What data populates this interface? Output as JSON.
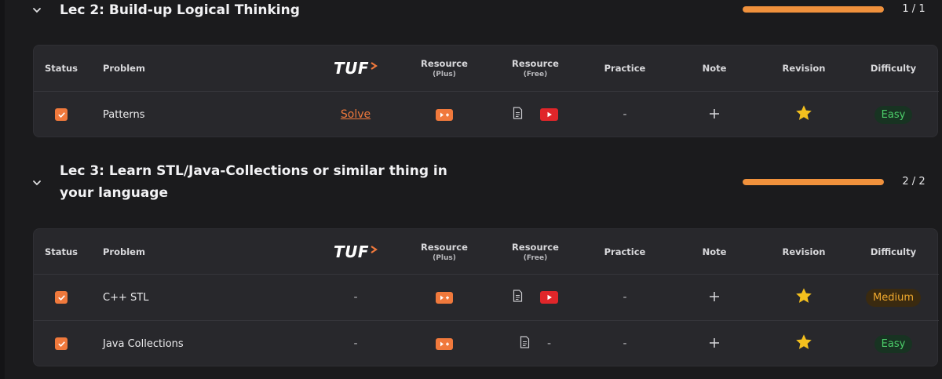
{
  "columns": {
    "status": "Status",
    "problem": "Problem",
    "resource_plus": "Resource",
    "resource_plus_sub": "(Plus)",
    "resource_free": "Resource",
    "resource_free_sub": "(Free)",
    "practice": "Practice",
    "note": "Note",
    "revision": "Revision",
    "difficulty": "Difficulty"
  },
  "logo_text": "TUF",
  "colors": {
    "accent": "#f0793c",
    "progress": "#f0913c",
    "easy": "#4ccf6a",
    "medium": "#f0a92e",
    "youtube": "#e0262a",
    "star": "#f4c01e"
  },
  "lectures": [
    {
      "title": "Lec 2: Build-up Logical Thinking",
      "progress_text": "1 / 1",
      "progress_fraction": 1.0,
      "problems": [
        {
          "status": "done",
          "name": "Patterns",
          "tuf": "Solve",
          "resource_plus": "plus-video-icon",
          "article": true,
          "youtube": true,
          "practice": "-",
          "note": "+",
          "revision": "star-icon",
          "difficulty": "Easy"
        }
      ]
    },
    {
      "title": "Lec 3: Learn STL/Java-Collections or similar thing in your language",
      "progress_text": "2 / 2",
      "progress_fraction": 1.0,
      "problems": [
        {
          "status": "done",
          "name": "C++ STL",
          "tuf": "-",
          "resource_plus": "plus-video-icon",
          "article": true,
          "youtube": true,
          "youtube_text": "",
          "practice": "-",
          "note": "+",
          "revision": "star-icon",
          "difficulty": "Medium"
        },
        {
          "status": "done",
          "name": "Java Collections",
          "tuf": "-",
          "resource_plus": "plus-video-icon",
          "article": true,
          "youtube": false,
          "youtube_text": "-",
          "practice": "-",
          "note": "+",
          "revision": "star-icon",
          "difficulty": "Easy"
        }
      ]
    }
  ]
}
